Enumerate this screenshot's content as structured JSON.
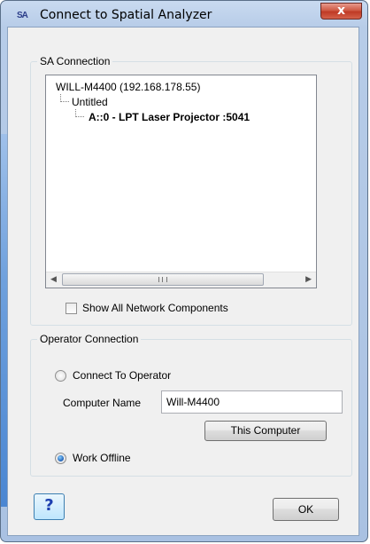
{
  "window": {
    "app_icon": "SA",
    "title": "Connect to Spatial Analyzer",
    "close_glyph": "x"
  },
  "sa_connection": {
    "group_label": "SA Connection",
    "tree": {
      "root": "WILL-M4400 (192.168.178.55)",
      "child": "Untitled",
      "grandchild": "A::0 - LPT Laser Projector  :5041"
    },
    "scroll": {
      "left_arrow": "◀",
      "right_arrow": "▶"
    },
    "show_all_label": "Show All Network Components",
    "show_all_checked": false
  },
  "operator_connection": {
    "group_label": "Operator Connection",
    "connect_label": "Connect To Operator",
    "computer_name_label": "Computer Name",
    "computer_name_value": "Will-M4400",
    "this_computer_button": "This Computer",
    "work_offline_label": "Work Offline",
    "selected": "work_offline"
  },
  "footer": {
    "help_glyph": "?",
    "ok_button": "OK"
  },
  "colors": {
    "frame": "#b7cce8",
    "close": "#c7432e",
    "client": "#f0f0f0"
  }
}
